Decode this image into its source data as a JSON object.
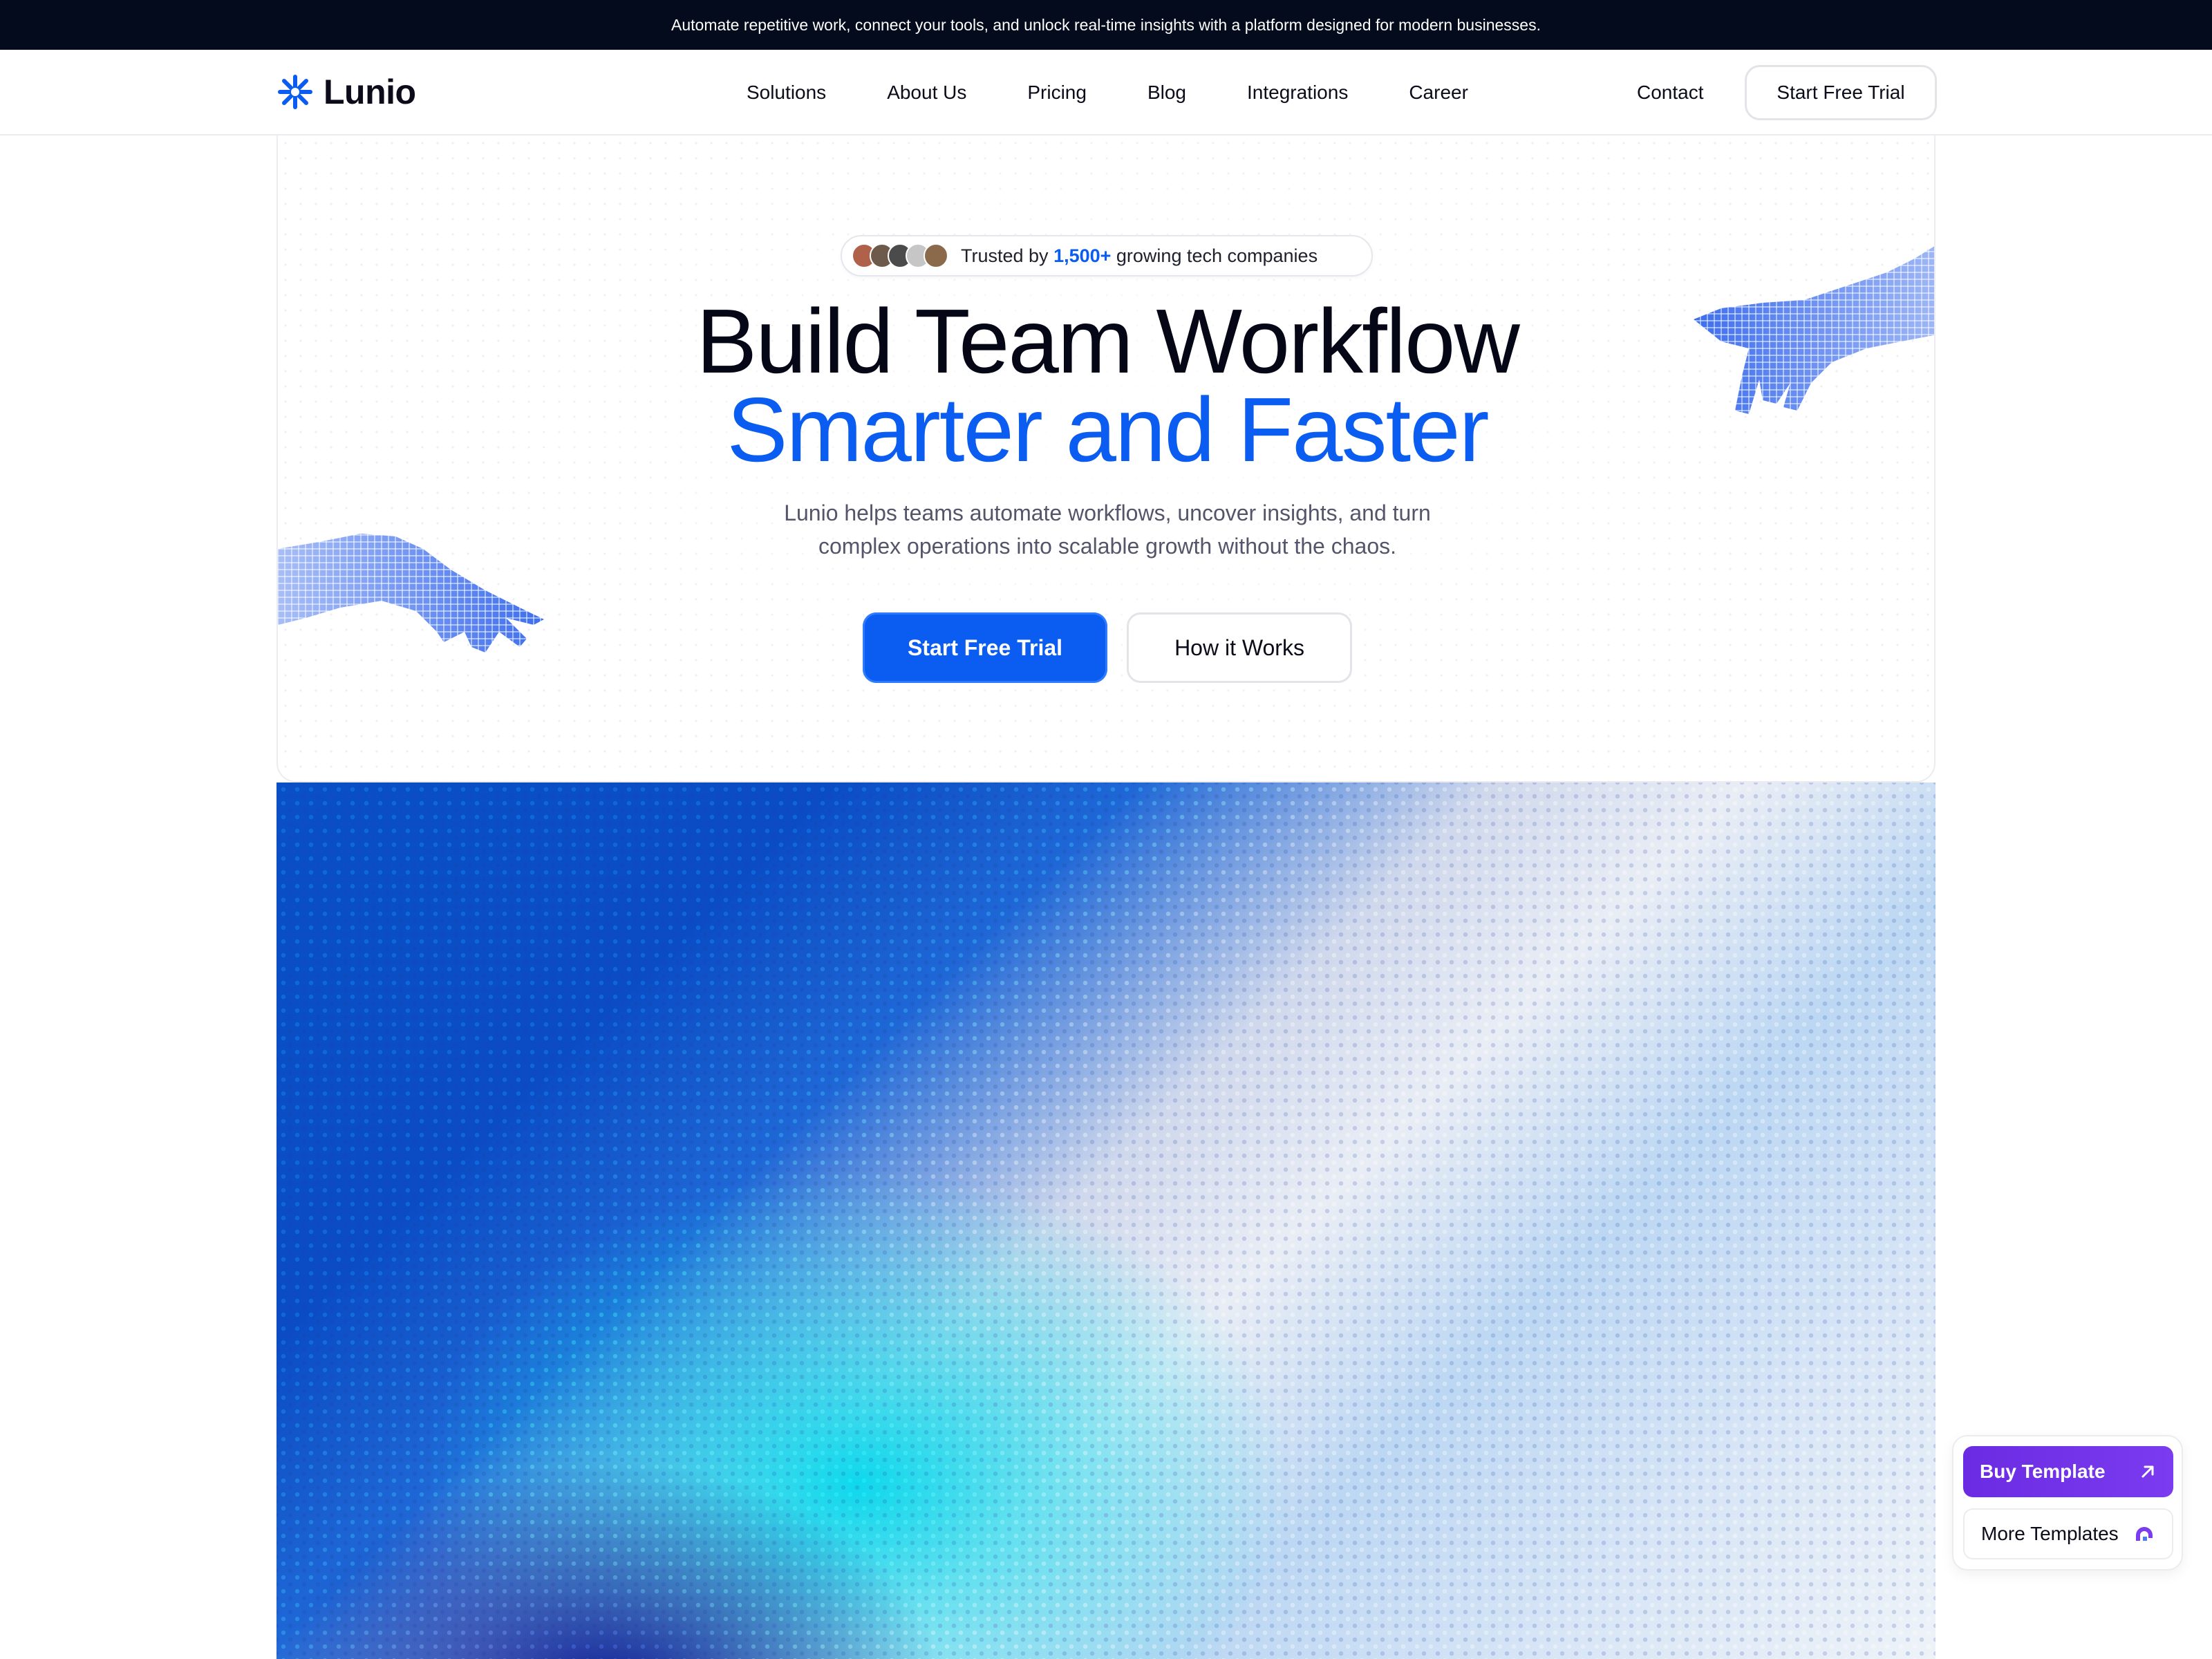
{
  "announcement": "Automate repetitive work, connect your tools, and unlock real-time insights with a platform designed for modern businesses.",
  "brand": {
    "name": "Lunio",
    "accent": "#0b5cf0"
  },
  "nav": {
    "links": [
      "Solutions",
      "About Us",
      "Pricing",
      "Blog",
      "Integrations",
      "Career"
    ],
    "contact": "Contact",
    "cta": "Start Free Trial"
  },
  "hero": {
    "trusted_prefix": "Trusted by ",
    "trusted_count": "1,500+",
    "trusted_suffix": " growing tech companies",
    "title_line1": "Build Team Workflow",
    "title_line2": "Smarter and Faster",
    "subtitle_line1": "Lunio helps teams automate workflows, uncover insights, and turn",
    "subtitle_line2": "complex operations into scalable growth without the chaos.",
    "primary_cta": "Start Free Trial",
    "secondary_cta": "How it Works",
    "avatar_colors": [
      "#b0614a",
      "#6d5a4a",
      "#4b4b4b",
      "#c6c6c6",
      "#8a6a4a"
    ]
  },
  "floating": {
    "buy_label": "Buy Template",
    "more_label": "More Templates",
    "buy_color": "#6a2be2"
  }
}
